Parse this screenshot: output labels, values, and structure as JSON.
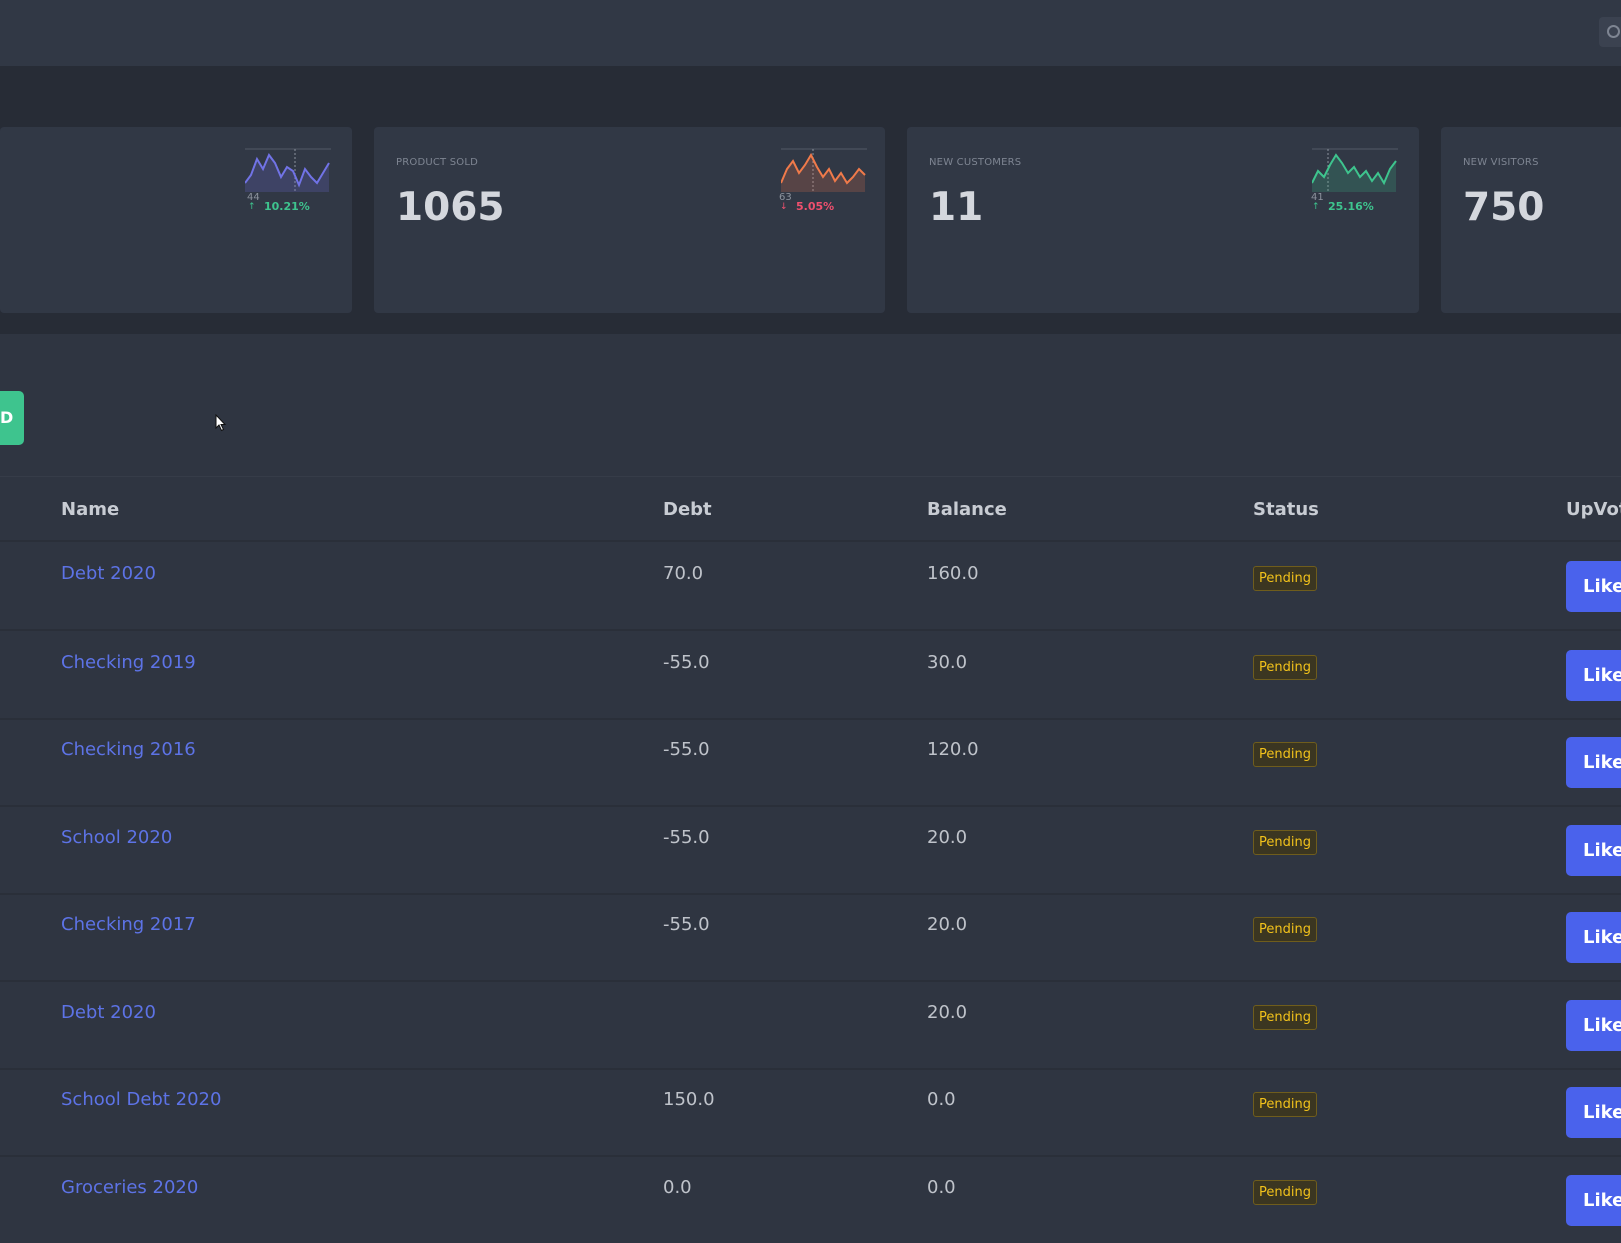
{
  "stats": [
    {
      "label": "",
      "value": "",
      "spark_num": "44",
      "percent": "10.21%",
      "trend": "up",
      "color": "#7173e6"
    },
    {
      "label": "PRODUCT SOLD",
      "value": "1065",
      "spark_num": "63",
      "percent": "5.05%",
      "trend": "down",
      "color": "#f07a4a"
    },
    {
      "label": "NEW CUSTOMERS",
      "value": "11",
      "spark_num": "41",
      "percent": "25.16%",
      "trend": "up",
      "color": "#3ec48e"
    },
    {
      "label": "NEW VISITORS",
      "value": "750"
    }
  ],
  "colors": {
    "up": "#3ec48e",
    "down": "#f0506e",
    "link": "#5d73e6",
    "badge": "#f2c21b",
    "primary": "#4a62ec"
  },
  "add_button_label": "D",
  "table": {
    "columns": [
      "Name",
      "Debt",
      "Balance",
      "Status",
      "UpVote"
    ],
    "rows": [
      {
        "name": "Debt 2020",
        "debt": "70.0",
        "balance": "160.0",
        "status": "Pending",
        "action": "Like"
      },
      {
        "name": "Checking 2019",
        "debt": "-55.0",
        "balance": "30.0",
        "status": "Pending",
        "action": "Like"
      },
      {
        "name": "Checking 2016",
        "debt": "-55.0",
        "balance": "120.0",
        "status": "Pending",
        "action": "Like"
      },
      {
        "name": "School 2020",
        "debt": "-55.0",
        "balance": "20.0",
        "status": "Pending",
        "action": "Like"
      },
      {
        "name": "Checking 2017",
        "debt": "-55.0",
        "balance": "20.0",
        "status": "Pending",
        "action": "Like"
      },
      {
        "name": "Debt 2020",
        "debt": "",
        "balance": "20.0",
        "status": "Pending",
        "action": "Like"
      },
      {
        "name": "School Debt 2020",
        "debt": "150.0",
        "balance": "0.0",
        "status": "Pending",
        "action": "Like"
      },
      {
        "name": "Groceries 2020",
        "debt": "0.0",
        "balance": "0.0",
        "status": "Pending",
        "action": "Like"
      }
    ]
  },
  "icons": {
    "search": "search-icon",
    "cursor": "mouse-cursor-icon",
    "arrow_up": "arrow-up-icon",
    "arrow_down": "arrow-down-icon"
  }
}
